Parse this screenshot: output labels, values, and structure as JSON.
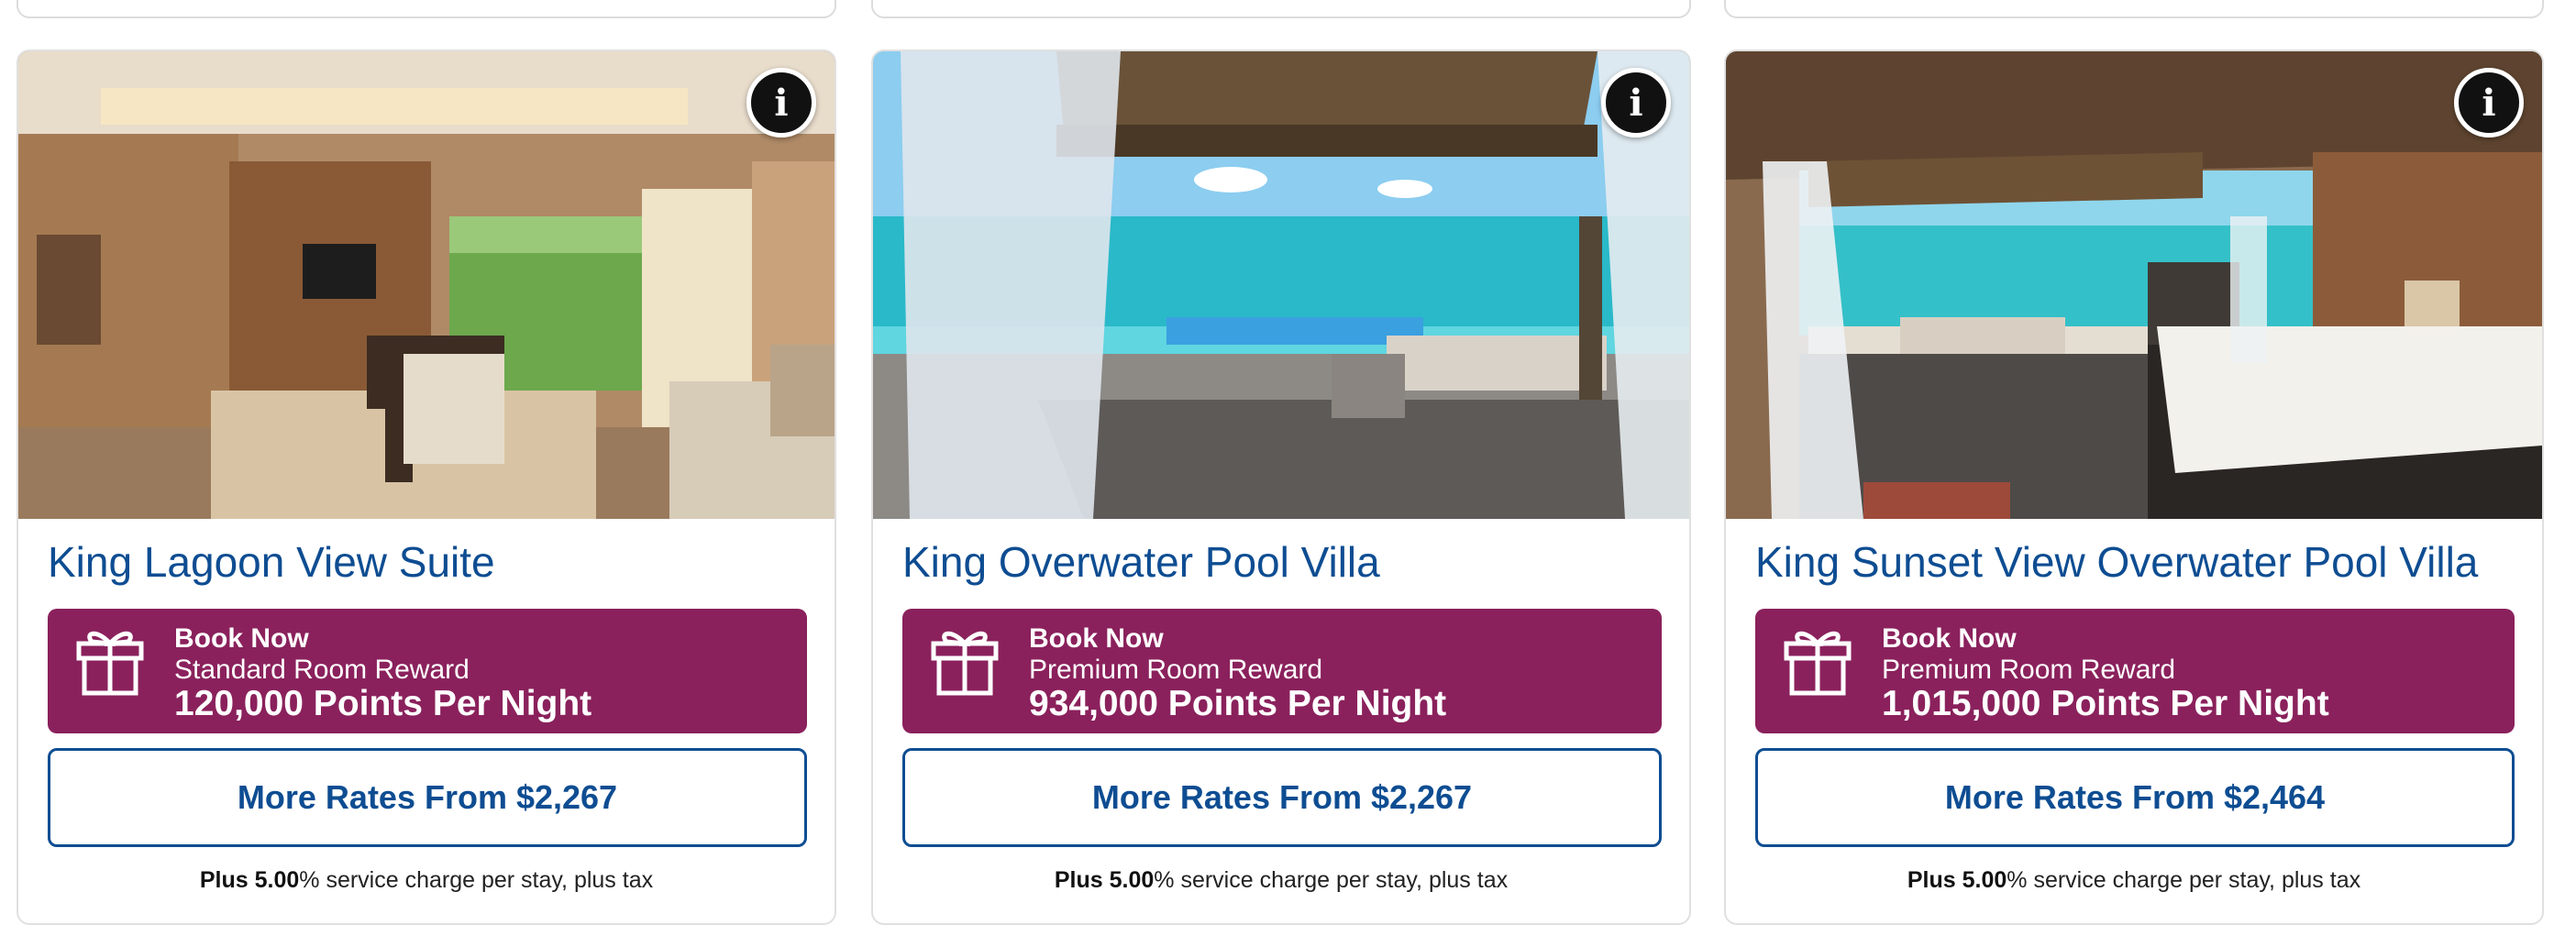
{
  "cards": [
    {
      "title": "King Lagoon View Suite",
      "info_icon": "info-icon",
      "reward": {
        "icon": "gift-icon",
        "action": "Book Now",
        "type": "Standard Room Reward",
        "points": "120,000 Points Per Night"
      },
      "more_rates": "More Rates From $2,267",
      "fee_bold": "Plus 5.00",
      "fee_rest": "% service charge per stay, plus tax"
    },
    {
      "title": "King Overwater Pool Villa",
      "info_icon": "info-icon",
      "reward": {
        "icon": "gift-icon",
        "action": "Book Now",
        "type": "Premium Room Reward",
        "points": "934,000 Points Per Night"
      },
      "more_rates": "More Rates From $2,267",
      "fee_bold": "Plus 5.00",
      "fee_rest": "% service charge per stay, plus tax"
    },
    {
      "title": "King Sunset View Overwater Pool Villa",
      "info_icon": "info-icon",
      "reward": {
        "icon": "gift-icon",
        "action": "Book Now",
        "type": "Premium Room Reward",
        "points": "1,015,000 Points Per Night"
      },
      "more_rates": "More Rates From $2,464",
      "fee_bold": "Plus 5.00",
      "fee_rest": "% service charge per stay, plus tax"
    }
  ],
  "colors": {
    "title": "#0e4d92",
    "reward_bg": "#8a215c",
    "button_border": "#0e4d92",
    "card_border": "#e0e0e0"
  }
}
